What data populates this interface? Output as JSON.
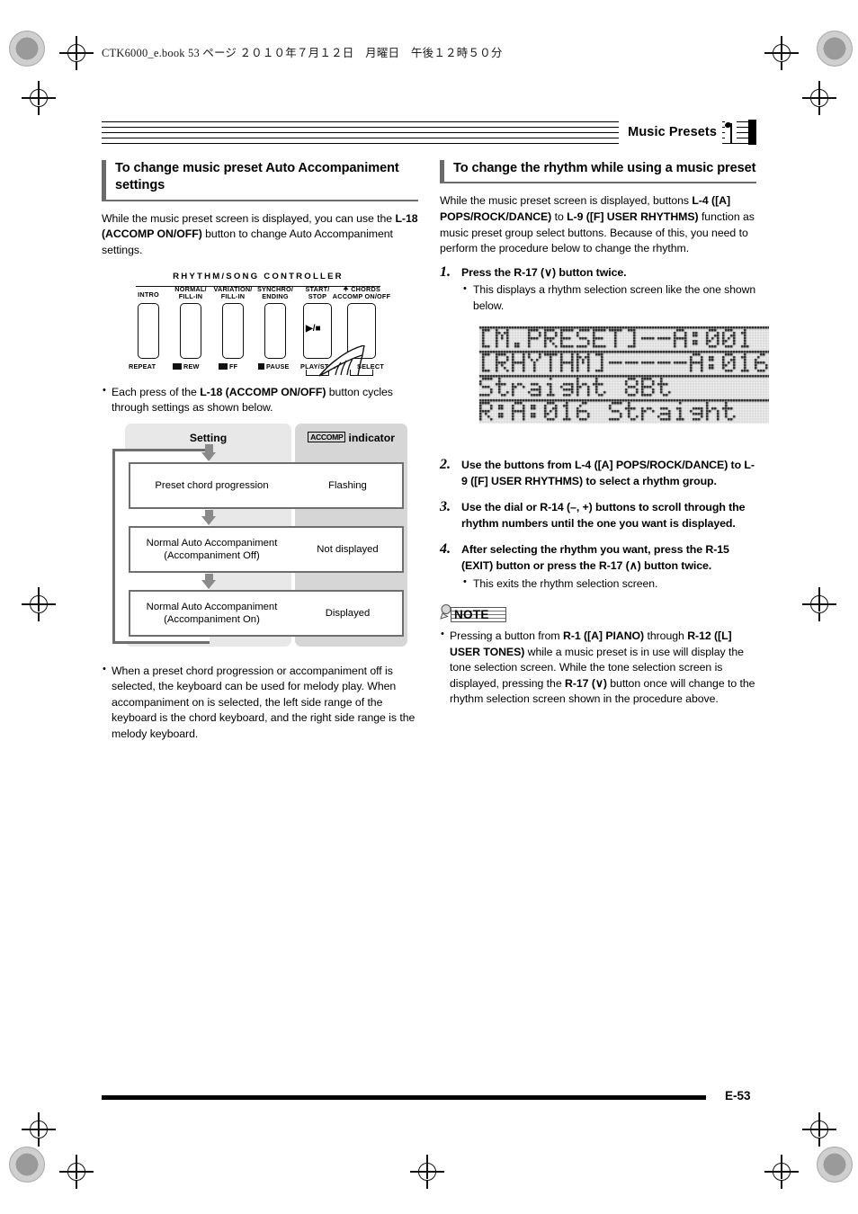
{
  "file_header": "CTK6000_e.book    53 ページ    ２０１０年７月１２日　月曜日　午後１２時５０分",
  "running_head": {
    "title": "Music Presets"
  },
  "footer": {
    "page_label": "E-53"
  },
  "left_column": {
    "heading": "To change music preset Auto Accompaniment settings",
    "intro_pre": "While the music preset screen is displayed, you can use the ",
    "intro_bold": "L-18 (ACCOMP ON/OFF)",
    "intro_post": " button to change Auto Accompaniment settings.",
    "figure": {
      "title": "RHYTHM/SONG CONTROLLER",
      "buttons": [
        {
          "top": "INTRO",
          "bottom": "REPEAT",
          "icon": ""
        },
        {
          "top": "NORMAL/ FILL-IN",
          "bottom": "REW",
          "icon": "rewind-icon"
        },
        {
          "top": "VARIATION/ FILL-IN",
          "bottom": "FF",
          "icon": "fast-forward-icon"
        },
        {
          "top": "SYNCHRO/ ENDING",
          "bottom": "PAUSE",
          "icon": "pause-icon"
        },
        {
          "top": "START/ STOP",
          "bottom": "PLAY/STOP",
          "icon": "play-stop-icon"
        },
        {
          "top": "CHORDS ACCOMP ON/OFF",
          "bottom": "SELECT",
          "icon": "chord-icon"
        }
      ],
      "play_glyph": "▶/■"
    },
    "bullet_cycle_pre": "Each press of the ",
    "bullet_cycle_bold": "L-18 (ACCOMP ON/OFF)",
    "bullet_cycle_post": " button cycles through settings as shown below.",
    "table": {
      "header_setting": "Setting",
      "header_indicator_chip": "ACCOMP",
      "header_indicator_text": "indicator",
      "rows": [
        {
          "setting_line1": "Preset chord progression",
          "setting_line2": "",
          "indicator": "Flashing"
        },
        {
          "setting_line1": "Normal Auto Accompaniment",
          "setting_line2": "(Accompaniment Off)",
          "indicator": "Not displayed"
        },
        {
          "setting_line1": "Normal Auto Accompaniment",
          "setting_line2": "(Accompaniment On)",
          "indicator": "Displayed"
        }
      ]
    },
    "bullet_keyboard": "When a preset chord progression or accompaniment off is selected, the keyboard can be used for melody play. When accompaniment on is selected, the left side range of the keyboard is the chord keyboard, and the right side range is the melody keyboard."
  },
  "right_column": {
    "heading": "To change the rhythm while using a music preset",
    "intro_p1": "While the music preset screen is displayed, buttons ",
    "intro_b1": "L-4 ([A] POPS/ROCK/DANCE)",
    "intro_p2": " to ",
    "intro_b2": "L-9 ([F] USER RHYTHMS)",
    "intro_p3": " function as music preset group select buttons. Because of this, you need to perform the procedure below to change the rhythm.",
    "steps": [
      {
        "num": "1.",
        "text": "Press the R-17 (∨) button twice.",
        "sub": [
          "This displays a rhythm selection screen like the one shown below."
        ]
      },
      {
        "num": "2.",
        "text": "Use the buttons from L-4 ([A] POPS/ROCK/DANCE) to L-9 ([F] USER RHYTHMS) to select a rhythm group.",
        "sub": []
      },
      {
        "num": "3.",
        "text": "Use the dial or R-14 (–, +) buttons to scroll through the rhythm numbers until the one you want is displayed.",
        "sub": []
      },
      {
        "num": "4.",
        "text": "After selecting the rhythm you want, press the R-15 (EXIT) button or press the R-17 (∧) button twice.",
        "sub": [
          "This exits the rhythm selection screen."
        ]
      }
    ],
    "lcd": {
      "lines": [
        "[M.PRESET]——A:001",
        "[RHYTHM]-----A:016",
        "Straight 8Bt",
        "R:A:016 Straight"
      ]
    },
    "note": {
      "label": "NOTE",
      "body_p1": "Pressing a button from ",
      "body_b1": "R-1 ([A] PIANO)",
      "body_p2": " through ",
      "body_b2": "R-12 ([L] USER TONES)",
      "body_p3": " while a music preset is in use will display the tone selection screen. While the tone selection screen is displayed, pressing the ",
      "body_b3": "R-17 (∨)",
      "body_p4": " button once will change to the rhythm selection screen shown in the procedure above."
    }
  }
}
